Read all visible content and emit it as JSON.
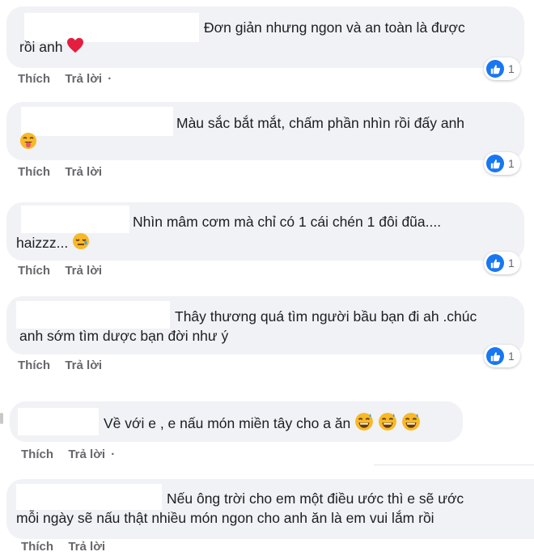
{
  "actions": {
    "like_label": "Thích",
    "reply_label": "Trả lời",
    "separator": "·"
  },
  "comments": [
    {
      "lines": [
        "Đơn giản nhưng ngon và an toàn là được",
        "rồi anh"
      ],
      "reaction_count": "1"
    },
    {
      "lines": [
        "Màu sắc bắt mắt, chấm phần nhìn rồi đấy anh",
        ""
      ],
      "reaction_count": "1"
    },
    {
      "lines": [
        "Nhìn mâm cơm mà chỉ có 1 cái chén 1 đôi đũa....",
        "haizzz..."
      ],
      "reaction_count": "1"
    },
    {
      "lines": [
        "Thây thương quá tìm người bầu bạn đi ah .chúc",
        "anh sớm tìm dược bạn đời như ý"
      ],
      "reaction_count": "1"
    },
    {
      "lines": [
        "Về với e , e nấu món miền tây cho a ăn"
      ]
    },
    {
      "lines": [
        "Nếu ông trời cho em một điều ước thì e sẽ ước",
        "mỗi ngày sẽ nấu thật nhiều món ngon cho anh ăn là em vui lắm rồi"
      ]
    }
  ],
  "icons": {
    "heart": "red-heart-icon",
    "like": "like-icon",
    "emoji_tongue": "face-tongue-icon",
    "emoji_sleepy": "sleepy-face-icon",
    "emoji_grin_sweat": "grinning-sweat-icon"
  },
  "colors": {
    "bubble": "#f0f2f5",
    "text": "#1c1e21",
    "meta": "#65676b",
    "like_blue": "#1877f2",
    "heart_red": "#e41e3f"
  }
}
